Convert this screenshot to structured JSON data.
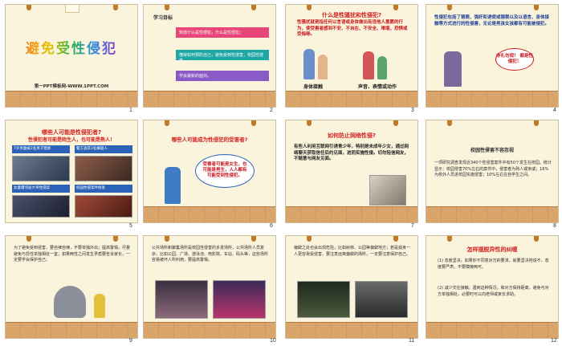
{
  "slides": [
    {
      "num": "1",
      "title": "避免受性侵犯",
      "subtitle": "第一PPT模板网-WWW.1PPT.COM"
    },
    {
      "num": "2",
      "heading": "学习目标",
      "items": [
        "知道什么是性侵犯，什么是性侵犯；",
        "懂得如何预防自己，避免受到性侵害，校园性侵害",
        "学会最新的面对。"
      ]
    },
    {
      "num": "3",
      "title": "什么是性骚扰和性侵犯?",
      "text": "性骚扰就是指任何以言语或身体做出有违他人意愿的行为，使受害者感到不安、不自在、不安全、难堪、恐惧或受侮辱。",
      "captions": [
        "身体接触",
        "声音、表情或动作"
      ]
    },
    {
      "num": "4",
      "text": "性侵犯包括了猥亵、强奸和诱使或猥亵以及以语言、身体接触等方式进行的性侵害，无论是男孩女孩都有可能被侵犯。",
      "bubble": "非礼勿视！ 都是性侵犯！"
    },
    {
      "num": "5",
      "title": "哪些人可能是性侵犯者?",
      "text": "性侵犯者可能是陌生人，也可能是熟人！",
      "news": [
        "7岁男童被2名男子猥亵",
        "警方查获3名嫌疑人",
        "女童遭邻居大爷性侵案",
        "校园性侵案件频发"
      ]
    },
    {
      "num": "6",
      "title": "哪些人可能成为性侵犯的受害者?",
      "bubble": "受害者可能是女生，也可能是男生，人人都有可能受到性侵犯。"
    },
    {
      "num": "7",
      "title": "如何防止网络性侵?",
      "text": "有些人利用互联网引诱青少年，特别是未成年少女，通过网络聊天获取信任后约见面，进而实施性侵。切勿轻信网友，不随意与网友见面。"
    },
    {
      "num": "8",
      "title": "校园性侵害不容忽视",
      "text": "一项研究调查发现近340个性侵害案件中有50个发生在校园。统计显示：校园侵害70%左右的案件中，侵害者为熟人或亲戚；16%为校外人员进校园实施侵害；10%左右在自学生之间。"
    },
    {
      "num": "9",
      "text": "为了避免受到侵害，要自律自律，不要单独外出；提高警惕，尽量避免与异性单独相处一室；如果两性之间发生矛盾要告诉家长，一定要学会保护自己。"
    },
    {
      "num": "10",
      "text": "公共场所和聚集场所是校园性侵害的多发场所，公共场所人员复杂，比如公园、广场、游泳池、电影院、车站、码头等，这些场所容易被坏人所利用，要提高警惕。"
    },
    {
      "num": "11",
      "text": "偏僻之处也会出现危险，比如树林、公园等偏僻地方；若是孤身一人更容易受侵害，要注意远离偏僻的场所，一定要注意保护自己。"
    },
    {
      "num": "12",
      "title": "怎样摆脱异性的纠缠",
      "items": [
        "(1) 态度坚决。如果你不同意对方的要求，就要坚决地说不，态度要严肃，不要模棱两可。",
        "(2) 减少交往接触。遇到这种情况，和对方保持距离，避免与对方单独相处，必要时可以向老师或家长求助。"
      ]
    }
  ],
  "colors": {
    "accent": "#d21f1f",
    "slide_bg": "#fbf4dc",
    "floor": "#d9a56a",
    "bar_pink": "#e8467a",
    "bar_teal": "#1fa7a5",
    "bar_purple": "#8a5ac7",
    "bar_green": "#4aa34e"
  }
}
